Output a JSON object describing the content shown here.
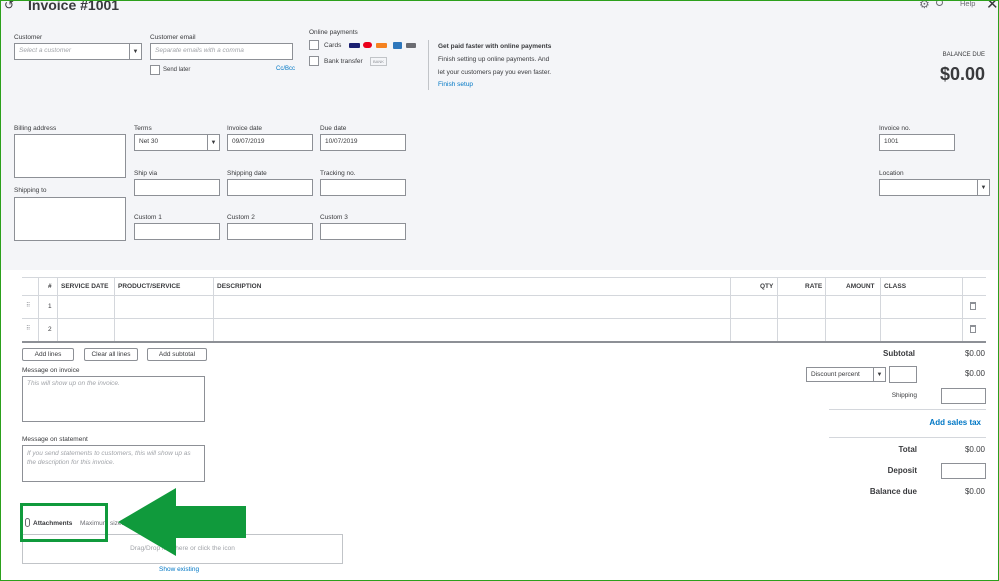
{
  "header": {
    "title": "Invoice #1001",
    "help_label": "Help"
  },
  "customer": {
    "label": "Customer",
    "placeholder": "Select a customer"
  },
  "customer_email": {
    "label": "Customer email",
    "placeholder": "Separate emails with a comma",
    "send_later": "Send later",
    "cc_bcc": "Cc/Bcc"
  },
  "online_payments": {
    "label": "Online payments",
    "cards": "Cards",
    "bank_transfer": "Bank transfer",
    "bank_badge": "BANK",
    "promo_title": "Get paid faster with online payments",
    "promo_line1": "Finish setting up online payments. And",
    "promo_line2": "let your customers pay you even faster.",
    "finish_setup": "Finish setup"
  },
  "balance": {
    "label": "BALANCE DUE",
    "amount": "$0.00"
  },
  "billing_address": {
    "label": "Billing address"
  },
  "shipping_to": {
    "label": "Shipping to"
  },
  "terms": {
    "label": "Terms",
    "value": "Net 30"
  },
  "invoice_date": {
    "label": "Invoice date",
    "value": "09/07/2019"
  },
  "due_date": {
    "label": "Due date",
    "value": "10/07/2019"
  },
  "ship_via": {
    "label": "Ship via"
  },
  "shipping_date": {
    "label": "Shipping date"
  },
  "tracking_no": {
    "label": "Tracking no."
  },
  "custom1": {
    "label": "Custom 1"
  },
  "custom2": {
    "label": "Custom 2"
  },
  "custom3": {
    "label": "Custom 3"
  },
  "invoice_no": {
    "label": "Invoice no.",
    "value": "1001"
  },
  "location": {
    "label": "Location"
  },
  "table": {
    "columns": [
      "#",
      "SERVICE DATE",
      "PRODUCT/SERVICE",
      "DESCRIPTION",
      "QTY",
      "RATE",
      "AMOUNT",
      "CLASS"
    ],
    "rows": [
      {
        "num": "1"
      },
      {
        "num": "2"
      }
    ]
  },
  "buttons": {
    "add_lines": "Add lines",
    "clear_all": "Clear all lines",
    "add_subtotal": "Add subtotal"
  },
  "message_invoice": {
    "label": "Message on invoice",
    "placeholder": "This will show up on the invoice."
  },
  "message_statement": {
    "label": "Message on statement",
    "placeholder_line1": "If you send statements to customers, this will show up as",
    "placeholder_line2": "the description for this invoice."
  },
  "attachments": {
    "label": "Attachments",
    "max_size": "Maximum size: 25MB",
    "drop_text": "Drag/Drop files here or click the icon",
    "show_existing": "Show existing"
  },
  "totals": {
    "subtotal_label": "Subtotal",
    "subtotal_value": "$0.00",
    "discount_label": "Discount percent",
    "discount_value": "$0.00",
    "shipping_label": "Shipping",
    "add_sales_tax": "Add sales tax",
    "total_label": "Total",
    "total_value": "$0.00",
    "deposit_label": "Deposit",
    "balance_due_label": "Balance due",
    "balance_due_value": "$0.00"
  },
  "colors": {
    "accent_link": "#0077c5",
    "highlight_green": "#109a3c",
    "frame_green": "#2ca01c"
  }
}
